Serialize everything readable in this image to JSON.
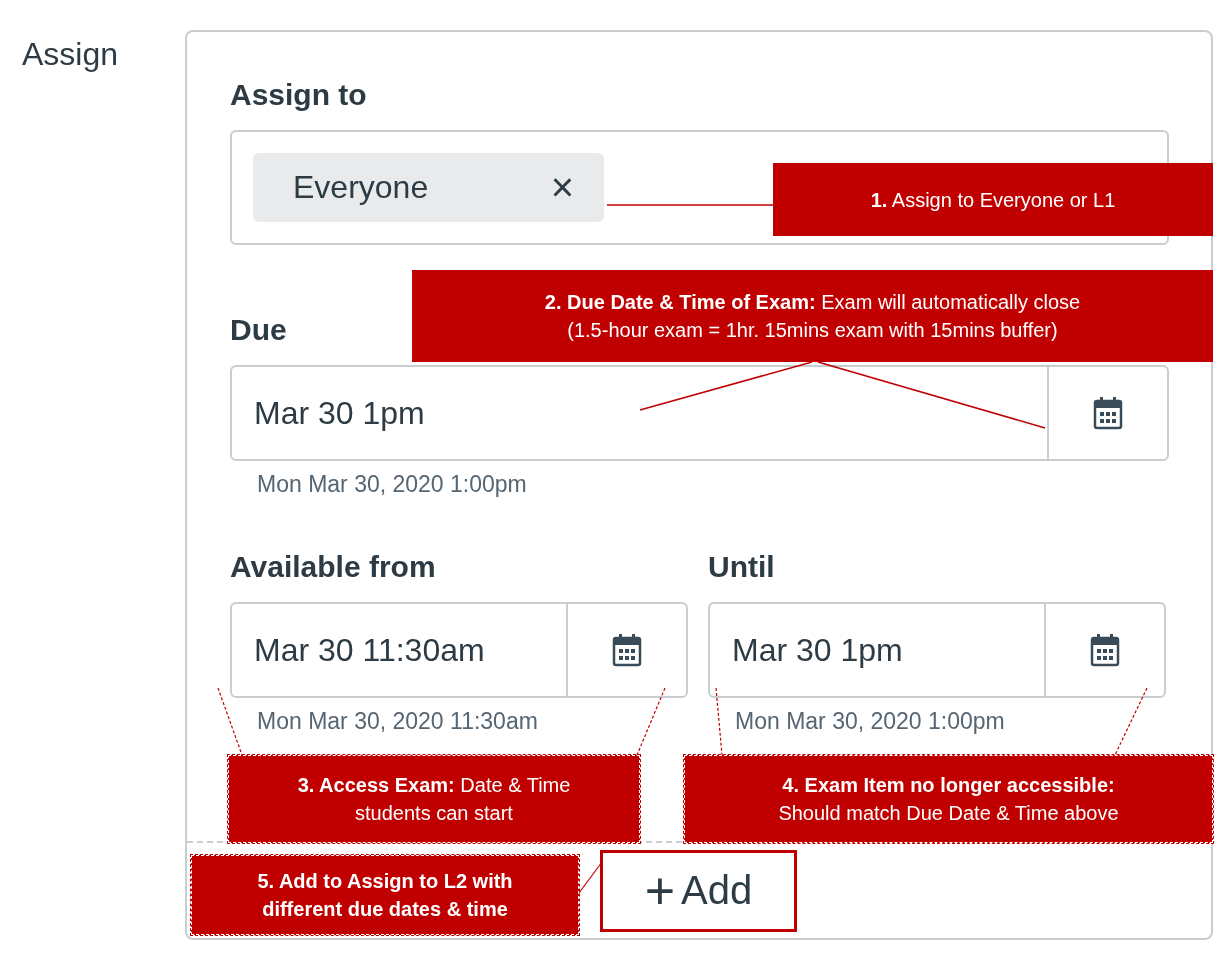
{
  "section_label": "Assign",
  "assign_to": {
    "heading": "Assign to",
    "tags": [
      {
        "label": "Everyone",
        "remove": "×"
      }
    ]
  },
  "due": {
    "heading": "Due",
    "value": "Mar 30 1pm",
    "hint": "Mon Mar 30, 2020 1:00pm"
  },
  "available_from": {
    "heading": "Available from",
    "value": "Mar 30 11:30am",
    "hint": "Mon Mar 30, 2020 11:30am"
  },
  "until": {
    "heading": "Until",
    "value": "Mar 30 1pm",
    "hint": "Mon Mar 30, 2020 1:00pm"
  },
  "add_button": {
    "icon": "+",
    "label": "Add"
  },
  "annotations": [
    {
      "lines": [
        "**1.**  Assign to Everyone or L1"
      ]
    },
    {
      "lines": [
        "**2. Due Date & Time of Exam:** Exam will automatically close",
        "(1.5-hour exam = 1hr. 15mins exam with 15mins buffer)"
      ]
    },
    {
      "lines": [
        "**3.  Access Exam:**  Date & Time",
        "students can start"
      ]
    },
    {
      "lines": [
        "**4.  Exam Item no longer accessible:**",
        "Should match Due Date & Time above"
      ]
    },
    {
      "lines": [
        "**5. Add to Assign to L2 with**",
        "**different due dates & time**"
      ]
    }
  ]
}
